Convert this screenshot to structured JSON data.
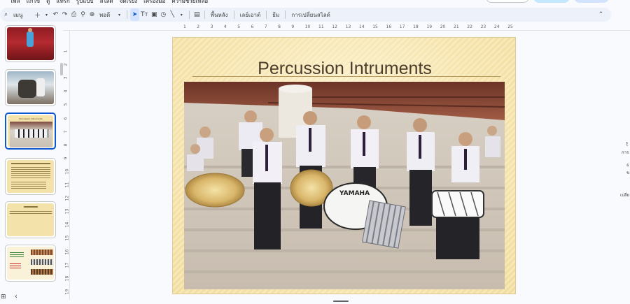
{
  "menu": {
    "items": [
      "ไฟล์",
      "แก้ไข",
      "ดู",
      "แทรก",
      "รูปแบบ",
      "สไลด์",
      "จัดเรียง",
      "เครื่องมือ",
      "ความช่วยเหลือ"
    ]
  },
  "toolbar": {
    "search_label": "เมนู",
    "zoom_label": "พอดี",
    "background_label": "พื้นหลัง",
    "layout_label": "เลย์เอาต์",
    "theme_label": "ธีม",
    "transition_label": "การเปลี่ยนสไลด์"
  },
  "slide": {
    "title": "Percussion Intruments"
  },
  "ruler": {
    "h_ticks": [
      "1",
      "2",
      "3",
      "4",
      "5",
      "6",
      "7",
      "8",
      "9",
      "10",
      "11",
      "12",
      "13",
      "14",
      "15",
      "16",
      "17",
      "18",
      "19",
      "20",
      "21",
      "22",
      "23",
      "24",
      "25"
    ],
    "v_ticks": [
      "1",
      "2",
      "3",
      "4",
      "5",
      "6",
      "7",
      "8",
      "9",
      "10",
      "11",
      "12",
      "13",
      "14",
      "15",
      "16",
      "17",
      "18",
      "19"
    ]
  },
  "thumbnails": [
    {
      "selected": false,
      "title": ""
    },
    {
      "selected": false,
      "title": ""
    },
    {
      "selected": true,
      "title": "Percussion Intruments"
    },
    {
      "selected": false,
      "title": ""
    },
    {
      "selected": false,
      "title": ""
    },
    {
      "selected": false,
      "title": ""
    }
  ],
  "right_panel": [
    "ใ",
    "การ",
    "ธ",
    "ข",
    "เปลี่ย"
  ],
  "colors": {
    "accent": "#0b57d0",
    "slide_bg": "#f6e7b6",
    "title": "#4a3b2b"
  }
}
